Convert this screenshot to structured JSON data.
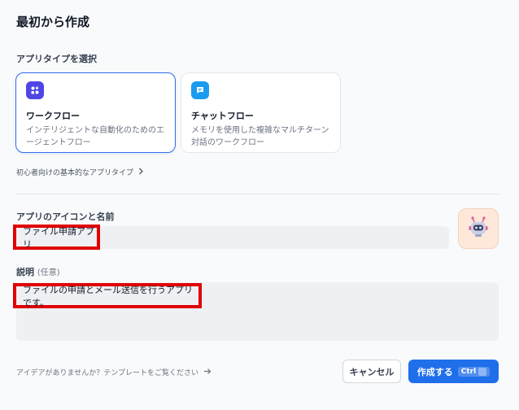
{
  "dialog": {
    "title": "最初から作成"
  },
  "app_type": {
    "label": "アプリタイプを選択",
    "options": [
      {
        "name": "ワークフロー",
        "desc": "インテリジェントな自動化のためのエージェントフロー",
        "selected": true,
        "icon": "workflow-icon",
        "color": "#4f46e5"
      },
      {
        "name": "チャットフロー",
        "desc": "メモリを使用した複雑なマルチターン対話のワークフロー",
        "selected": false,
        "icon": "chat-icon",
        "color": "#1a9bf0"
      }
    ],
    "beginner_link": "初心者向けの基本的なアプリタイプ"
  },
  "app_name": {
    "label": "アプリのアイコンと名前",
    "value": "ファイル申請アプリ",
    "avatar_icon": "robot-icon"
  },
  "description": {
    "label": "説明",
    "optional": "(任意)",
    "value": "ファイルの申請とメール送信を行うアプリです。"
  },
  "footer": {
    "idea_link": "アイデアがありませんか？テンプレートをご覧ください",
    "cancel_label": "キャンセル",
    "create_label": "作成する",
    "shortcut_label": "Ctrl"
  },
  "colors": {
    "accent": "#1f6feb",
    "highlight": "#e10000"
  }
}
